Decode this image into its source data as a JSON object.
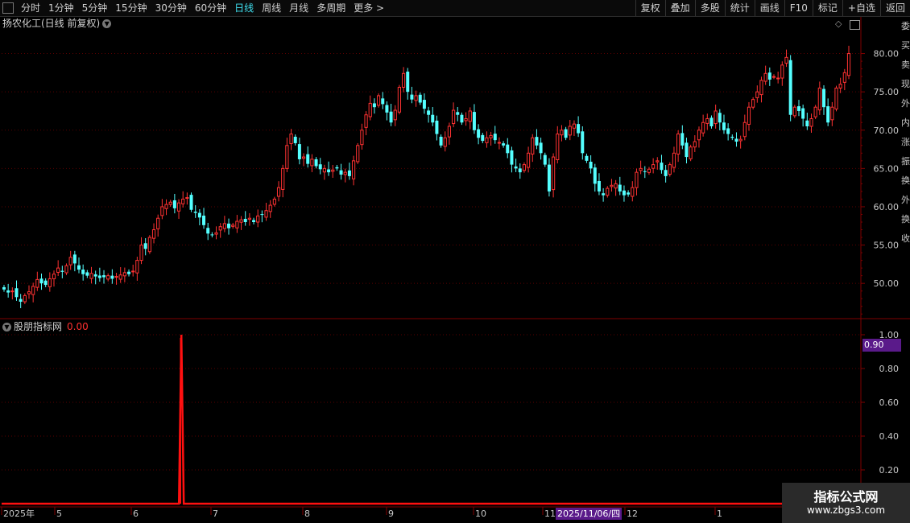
{
  "toolbar": {
    "periods": [
      "分时",
      "1分钟",
      "5分钟",
      "15分钟",
      "30分钟",
      "60分钟",
      "日线",
      "周线",
      "月线",
      "多周期",
      "更多 >"
    ],
    "active_period": "日线",
    "right_tools": [
      "复权",
      "叠加",
      "多股",
      "统计",
      "画线",
      "F10",
      "标记",
      "+自选",
      "返回"
    ]
  },
  "main_chart": {
    "title": "扬农化工(日线 前复权)",
    "price_labels": [
      "80.00",
      "75.00",
      "70.00",
      "65.00",
      "60.00",
      "55.00",
      "50.00"
    ]
  },
  "indicator": {
    "name": "股朋指标网",
    "value": "0.00",
    "axis_labels": [
      "1.00",
      "0.80",
      "0.60",
      "0.40",
      "0.20"
    ],
    "cursor_value": "0.90"
  },
  "time_axis": {
    "labels": [
      "2025年",
      "5",
      "6",
      "7",
      "8",
      "9",
      "10",
      "11",
      "12",
      "1"
    ],
    "cursor_date": "2025/11/06/四"
  },
  "watermark": {
    "line1": "指标公式网",
    "line2": "www.zbgs3.com"
  },
  "side_strip": {
    "chars": [
      "委",
      "买",
      "卖",
      "现",
      "外",
      "内",
      "涨",
      "振",
      "换",
      "外",
      "换",
      "收"
    ]
  },
  "colors": {
    "up": "#ff3232",
    "down": "#54ffff",
    "grid": "#5a0000",
    "axis": "#800000",
    "active": "#3fe0f0"
  },
  "chart_data": [
    {
      "type": "candlestick",
      "title": "扬农化工(日线 前复权)",
      "ylim": [
        45.5,
        83
      ],
      "yticks": [
        80,
        75,
        70,
        65,
        60,
        55,
        50
      ],
      "x_range": [
        "2025-04",
        "2026-02"
      ],
      "close": [
        49.2,
        48.8,
        49.0,
        48.2,
        47.6,
        48.4,
        48.9,
        49.6,
        50.5,
        50.0,
        49.8,
        50.6,
        51.2,
        52.0,
        51.5,
        52.3,
        53.4,
        52.6,
        51.8,
        51.2,
        51.0,
        51.3,
        50.9,
        50.7,
        50.8,
        51.0,
        50.6,
        50.9,
        51.1,
        51.4,
        51.2,
        51.6,
        53.0,
        55.0,
        54.5,
        56.0,
        57.0,
        58.5,
        60.0,
        60.3,
        60.6,
        59.8,
        60.5,
        61.0,
        61.2,
        59.6,
        59.2,
        58.6,
        57.6,
        56.5,
        56.3,
        56.6,
        57.4,
        57.8,
        57.2,
        57.6,
        58.1,
        58.3,
        58.0,
        58.5,
        58.0,
        58.8,
        59.0,
        59.5,
        60.2,
        61.0,
        62.5,
        65.0,
        68.0,
        69.5,
        68.3,
        66.2,
        66.5,
        65.6,
        66.2,
        65.3,
        64.9,
        65.0,
        64.5,
        64.8,
        65.0,
        64.2,
        64.5,
        64.0,
        66.0,
        68.0,
        70.0,
        72.0,
        73.5,
        73.0,
        74.5,
        73.4,
        72.3,
        71.0,
        72.6,
        75.6,
        77.4,
        75.0,
        74.0,
        74.5,
        73.6,
        72.8,
        72.0,
        71.0,
        69.5,
        68.0,
        69.0,
        70.5,
        72.6,
        72.0,
        71.0,
        71.5,
        72.5,
        70.0,
        69.0,
        68.6,
        69.0,
        69.3,
        68.7,
        68.4,
        68.0,
        67.0,
        65.5,
        65.0,
        64.5,
        65.5,
        67.0,
        69.0,
        68.0,
        67.0,
        65.5,
        62.0,
        66.5,
        69.5,
        70.0,
        69.0,
        70.5,
        70.8,
        69.6,
        67.0,
        66.0,
        65.0,
        63.0,
        62.0,
        61.5,
        62.4,
        62.8,
        63.0,
        62.0,
        61.5,
        61.6,
        62.5,
        64.5,
        65.0,
        64.6,
        64.9,
        65.5,
        66.0,
        64.8,
        64.0,
        65.5,
        67.0,
        69.5,
        68.0,
        66.5,
        67.8,
        68.5,
        70.0,
        71.0,
        71.5,
        70.5,
        72.5,
        71.0,
        70.0,
        69.5,
        69.0,
        68.5,
        68.8,
        71.0,
        73.0,
        74.0,
        75.0,
        76.5,
        77.4,
        76.6,
        77.0,
        76.8,
        78.5,
        79.5,
        72.0,
        73.0,
        72.5,
        71.5,
        70.5,
        71.5,
        73.0,
        75.5,
        73.0,
        71.0,
        73.0,
        75.5,
        76.0,
        77.5,
        80.0
      ]
    },
    {
      "type": "line",
      "name": "股朋指标网",
      "ylim": [
        0,
        1.0
      ],
      "spike_index": 43,
      "spike_value": 1.0,
      "baseline": 0.0
    }
  ]
}
